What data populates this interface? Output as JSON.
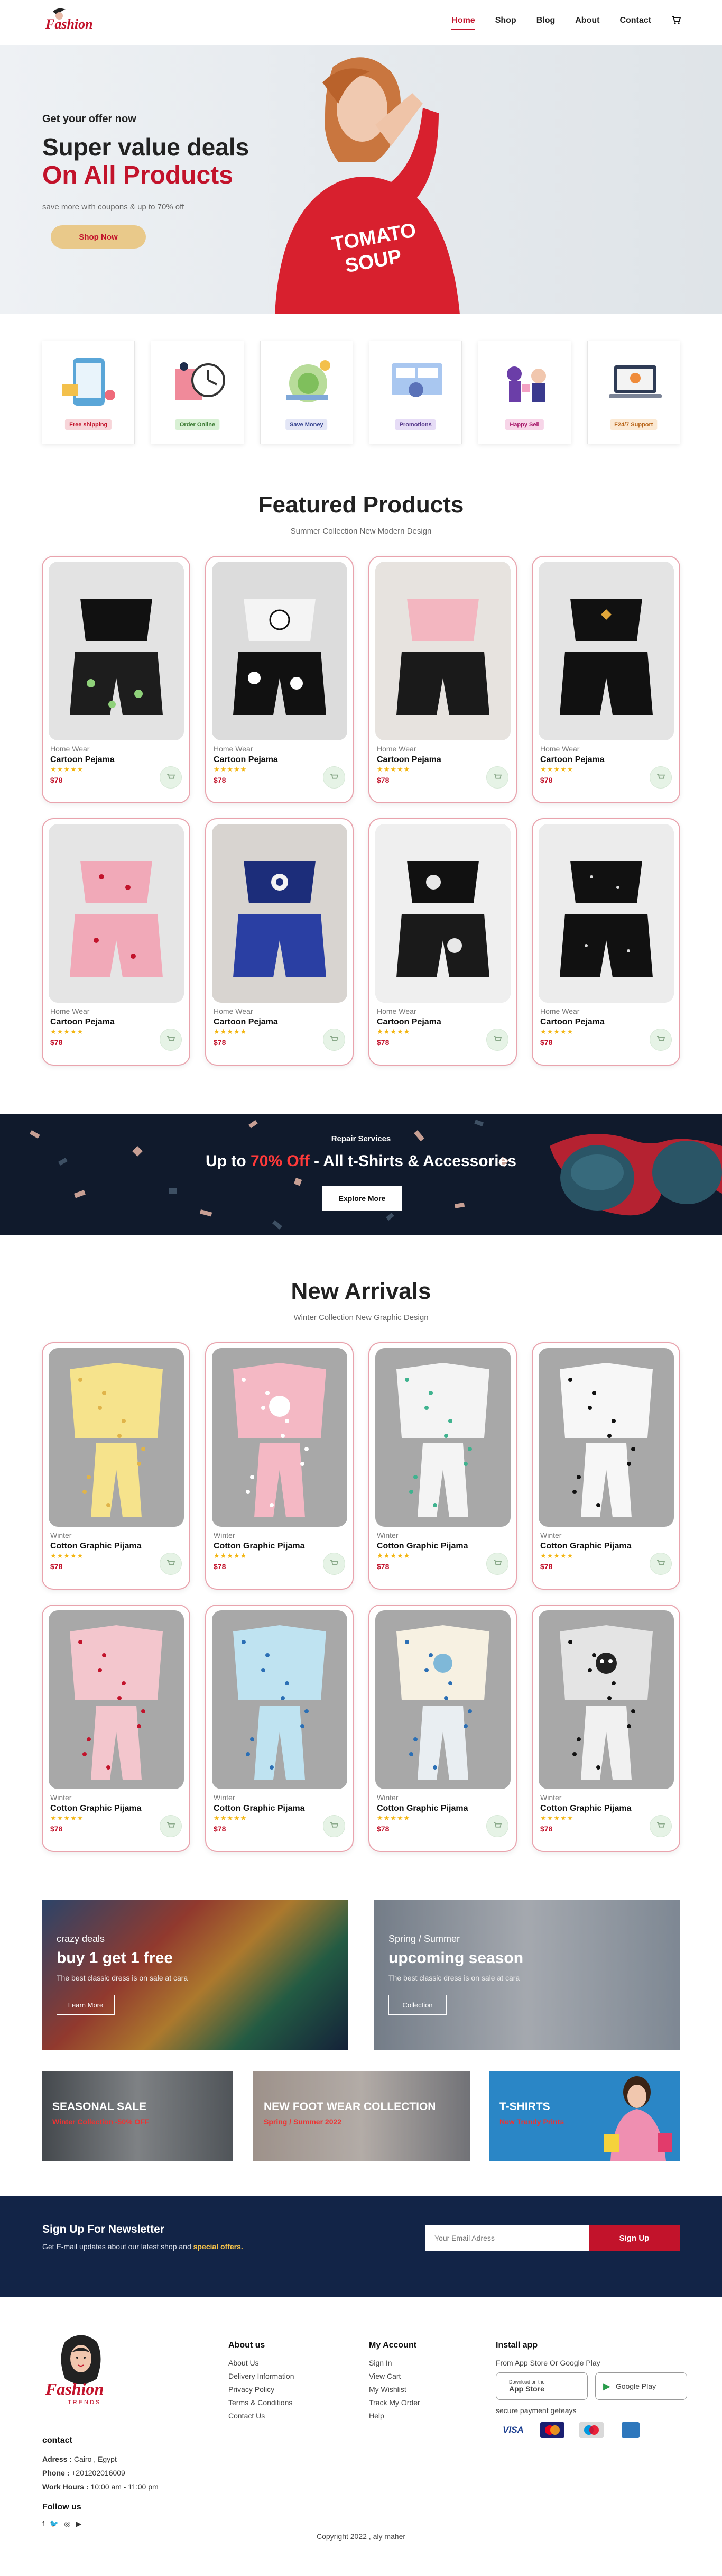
{
  "brand": {
    "logo_text": "Fashion",
    "logo_sub": "TRENDS"
  },
  "nav": {
    "items": [
      "Home",
      "Shop",
      "Blog",
      "About",
      "Contact"
    ],
    "active": "Home",
    "cart_icon": "cart-icon"
  },
  "hero": {
    "pre_title": "Get your offer now",
    "title_line1": "Super value deals",
    "title_line2": "On All Products",
    "subtitle": "save more with coupons & up to 70% off",
    "button": "Shop Now",
    "shirt_text_line1": "TOMATO",
    "shirt_text_line2": "SOUP"
  },
  "features": [
    {
      "label": "Free shipping",
      "bg": "#f7d5d9",
      "color": "#c2132b"
    },
    {
      "label": "Order Online",
      "bg": "#d8f0d4",
      "color": "#3a7a32"
    },
    {
      "label": "Save Money",
      "bg": "#e3e6f6",
      "color": "#36438f"
    },
    {
      "label": "Promotions",
      "bg": "#e6dcf6",
      "color": "#5a3d8e"
    },
    {
      "label": "Happy Sell",
      "bg": "#f7d5e8",
      "color": "#a8196b"
    },
    {
      "label": "F24/7 Support",
      "bg": "#fbe9d3",
      "color": "#b8651a"
    }
  ],
  "featured": {
    "title": "Featured Products",
    "subtitle": "Summer Collection New Modern Design",
    "products": [
      {
        "category": "Home Wear",
        "name": "Cartoon Pejama",
        "price": "$78",
        "stars": "★★★★★"
      },
      {
        "category": "Home Wear",
        "name": "Cartoon Pejama",
        "price": "$78",
        "stars": "★★★★★"
      },
      {
        "category": "Home Wear",
        "name": "Cartoon Pejama",
        "price": "$78",
        "stars": "★★★★★"
      },
      {
        "category": "Home Wear",
        "name": "Cartoon Pejama",
        "price": "$78",
        "stars": "★★★★★"
      },
      {
        "category": "Home Wear",
        "name": "Cartoon Pejama",
        "price": "$78",
        "stars": "★★★★★"
      },
      {
        "category": "Home Wear",
        "name": "Cartoon Pejama",
        "price": "$78",
        "stars": "★★★★★"
      },
      {
        "category": "Home Wear",
        "name": "Cartoon Pejama",
        "price": "$78",
        "stars": "★★★★★"
      },
      {
        "category": "Home Wear",
        "name": "Cartoon Pejama",
        "price": "$78",
        "stars": "★★★★★"
      }
    ]
  },
  "promo": {
    "label": "Repair Services",
    "text_before": "Up to ",
    "highlight": "70% Off",
    "text_after": " - All t-Shirts & Accessories",
    "button": "Explore More"
  },
  "arrivals": {
    "title": "New Arrivals",
    "subtitle": "Winter Collection New Graphic Design",
    "products": [
      {
        "category": "Winter",
        "name": "Cotton Graphic Pijama",
        "price": "$78",
        "stars": "★★★★★"
      },
      {
        "category": "Winter",
        "name": "Cotton Graphic Pijama",
        "price": "$78",
        "stars": "★★★★★"
      },
      {
        "category": "Winter",
        "name": "Cotton Graphic Pijama",
        "price": "$78",
        "stars": "★★★★★"
      },
      {
        "category": "Winter",
        "name": "Cotton Graphic Pijama",
        "price": "$78",
        "stars": "★★★★★"
      },
      {
        "category": "Winter",
        "name": "Cotton Graphic Pijama",
        "price": "$78",
        "stars": "★★★★★"
      },
      {
        "category": "Winter",
        "name": "Cotton Graphic Pijama",
        "price": "$78",
        "stars": "★★★★★"
      },
      {
        "category": "Winter",
        "name": "Cotton Graphic Pijama",
        "price": "$78",
        "stars": "★★★★★"
      },
      {
        "category": "Winter",
        "name": "Cotton Graphic Pijama",
        "price": "$78",
        "stars": "★★★★★"
      }
    ]
  },
  "banners": {
    "crazy": {
      "pre": "crazy deals",
      "title": "buy 1 get 1 free",
      "text": "The best classic dress is on sale at cara",
      "button": "Learn More"
    },
    "spring": {
      "pre": "Spring / Summer",
      "title": "upcoming season",
      "text": "The best classic dress is on sale at cara",
      "button": "Collection"
    },
    "seasonal": {
      "title": "SEASONAL SALE",
      "sub": "Winter Collection -50% OFF"
    },
    "footwear": {
      "title": "NEW FOOT WEAR COLLECTION",
      "sub": "Spring / Summer 2022"
    },
    "tshirts": {
      "title": "T-SHIRTS",
      "sub": "New Trendy Prints"
    }
  },
  "newsletter": {
    "title": "Sign Up For Newsletter",
    "text_before": "Get E-mail updates about our latest shop and ",
    "text_highlight": "special offers.",
    "placeholder": "Your Email Adress",
    "button": "Sign Up"
  },
  "footer": {
    "about": {
      "title": "About us",
      "links": [
        "About Us",
        "Delivery Information",
        "Privacy Policy",
        "Terms & Conditions",
        "Contact Us"
      ]
    },
    "account": {
      "title": "My Account",
      "links": [
        "Sign In",
        "View Cart",
        "My Wishlist",
        "Track My Order",
        "Help"
      ]
    },
    "app": {
      "title": "Install app",
      "text": "From App Store Or Google Play",
      "apple": "App Store",
      "apple_pre": "Download on the",
      "google": "Google Play",
      "secure": "secure payment geteays",
      "cards": [
        "VISA",
        "Mastercard",
        "Maestro",
        "AMEX"
      ]
    },
    "contact": {
      "title": "contact",
      "address_label": "Adress :",
      "address": "Cairo , Egypt",
      "phone_label": "Phone :",
      "phone": "+201202016009",
      "hours_label": "Work Hours :",
      "hours": "10:00 am - 11:00 pm",
      "follow": "Follow us"
    },
    "copyright": "Copyright 2022 , aly maher"
  }
}
